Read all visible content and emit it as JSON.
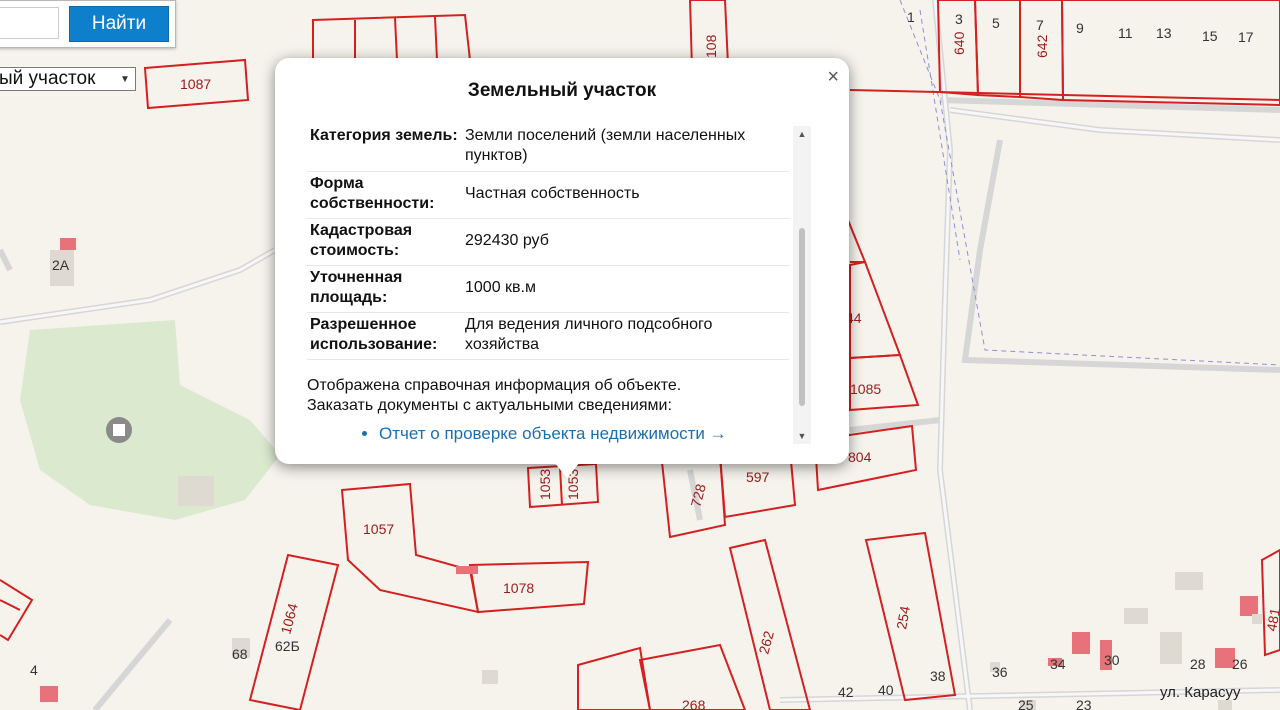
{
  "search": {
    "button_label": "Найти",
    "input_value": ""
  },
  "type_select": {
    "selected": "ый участок"
  },
  "popup": {
    "title": "Земельный участок",
    "close_icon": "×",
    "rows": [
      {
        "label": "Категория земель:",
        "value": "Земли поселений (земли населенных пунктов)"
      },
      {
        "label": "Форма собственности:",
        "value": "Частная собственность"
      },
      {
        "label": "Кадастровая стоимость:",
        "value": "292430 руб"
      },
      {
        "label": "Уточненная площадь:",
        "value": "1000 кв.м"
      },
      {
        "label": "Разрешенное использование:",
        "value": "Для ведения личного подсобного хозяйства"
      }
    ],
    "note_line1": "Отображена справочная информация об объекте.",
    "note_line2": "Заказать документы с актуальными сведениями:",
    "link_label": "Отчет о проверке объекта недвижимости →"
  },
  "map_labels": {
    "parcels": [
      "1087",
      "108",
      "640",
      "642",
      "1053",
      "1053",
      "728",
      "597",
      "804",
      "1085",
      "44",
      "1057",
      "1078",
      "1064",
      "262",
      "254",
      "268",
      "481"
    ],
    "houses": [
      "1",
      "3",
      "5",
      "7",
      "9",
      "11",
      "13",
      "15",
      "17",
      "2А",
      "62Б",
      "68",
      "4",
      "42",
      "40",
      "38",
      "36",
      "34",
      "30",
      "28",
      "26",
      "25",
      "23"
    ],
    "street": "ул. Карасуу"
  },
  "colors": {
    "parcel_border": "#d42020",
    "accent": "#0e7fca",
    "park": "#dbe9cf"
  }
}
